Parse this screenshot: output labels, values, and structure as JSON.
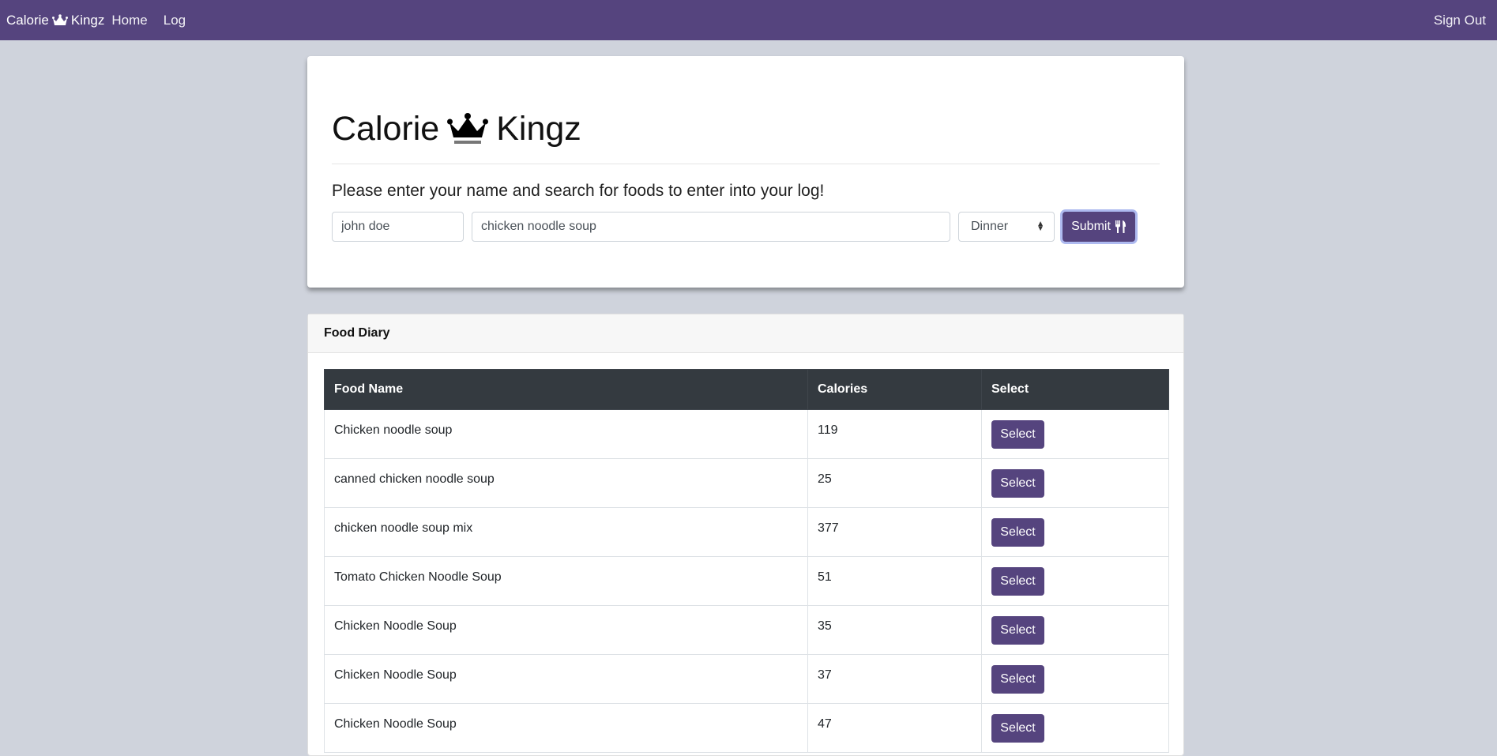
{
  "navbar": {
    "brand_left": "Calorie",
    "brand_right": "Kingz",
    "home": "Home",
    "log": "Log",
    "sign_out": "Sign Out",
    "bg_color": "#55447e"
  },
  "hero": {
    "title_left": "Calorie",
    "title_right": "Kingz",
    "lead": "Please enter your name and search for foods to enter into your log!",
    "name_value": "john doe",
    "food_value": "chicken noodle soup",
    "meal_value": "Dinner",
    "submit_label": "Submit"
  },
  "diary": {
    "header": "Food Diary",
    "columns": [
      "Food Name",
      "Calories",
      "Select"
    ],
    "rows": [
      {
        "name": "Chicken noodle soup",
        "calories": "119",
        "button": "Select"
      },
      {
        "name": "canned chicken noodle soup",
        "calories": "25",
        "button": "Select"
      },
      {
        "name": "chicken noodle soup mix",
        "calories": "377",
        "button": "Select"
      },
      {
        "name": "Tomato Chicken Noodle Soup",
        "calories": "51",
        "button": "Select"
      },
      {
        "name": "Chicken Noodle Soup",
        "calories": "35",
        "button": "Select"
      },
      {
        "name": "Chicken Noodle Soup",
        "calories": "37",
        "button": "Select"
      },
      {
        "name": "Chicken Noodle Soup",
        "calories": "47",
        "button": "Select"
      }
    ]
  },
  "icons": {
    "crown": "crown-icon",
    "utensils": "utensils-icon",
    "select_caret": "select-caret-icon"
  }
}
